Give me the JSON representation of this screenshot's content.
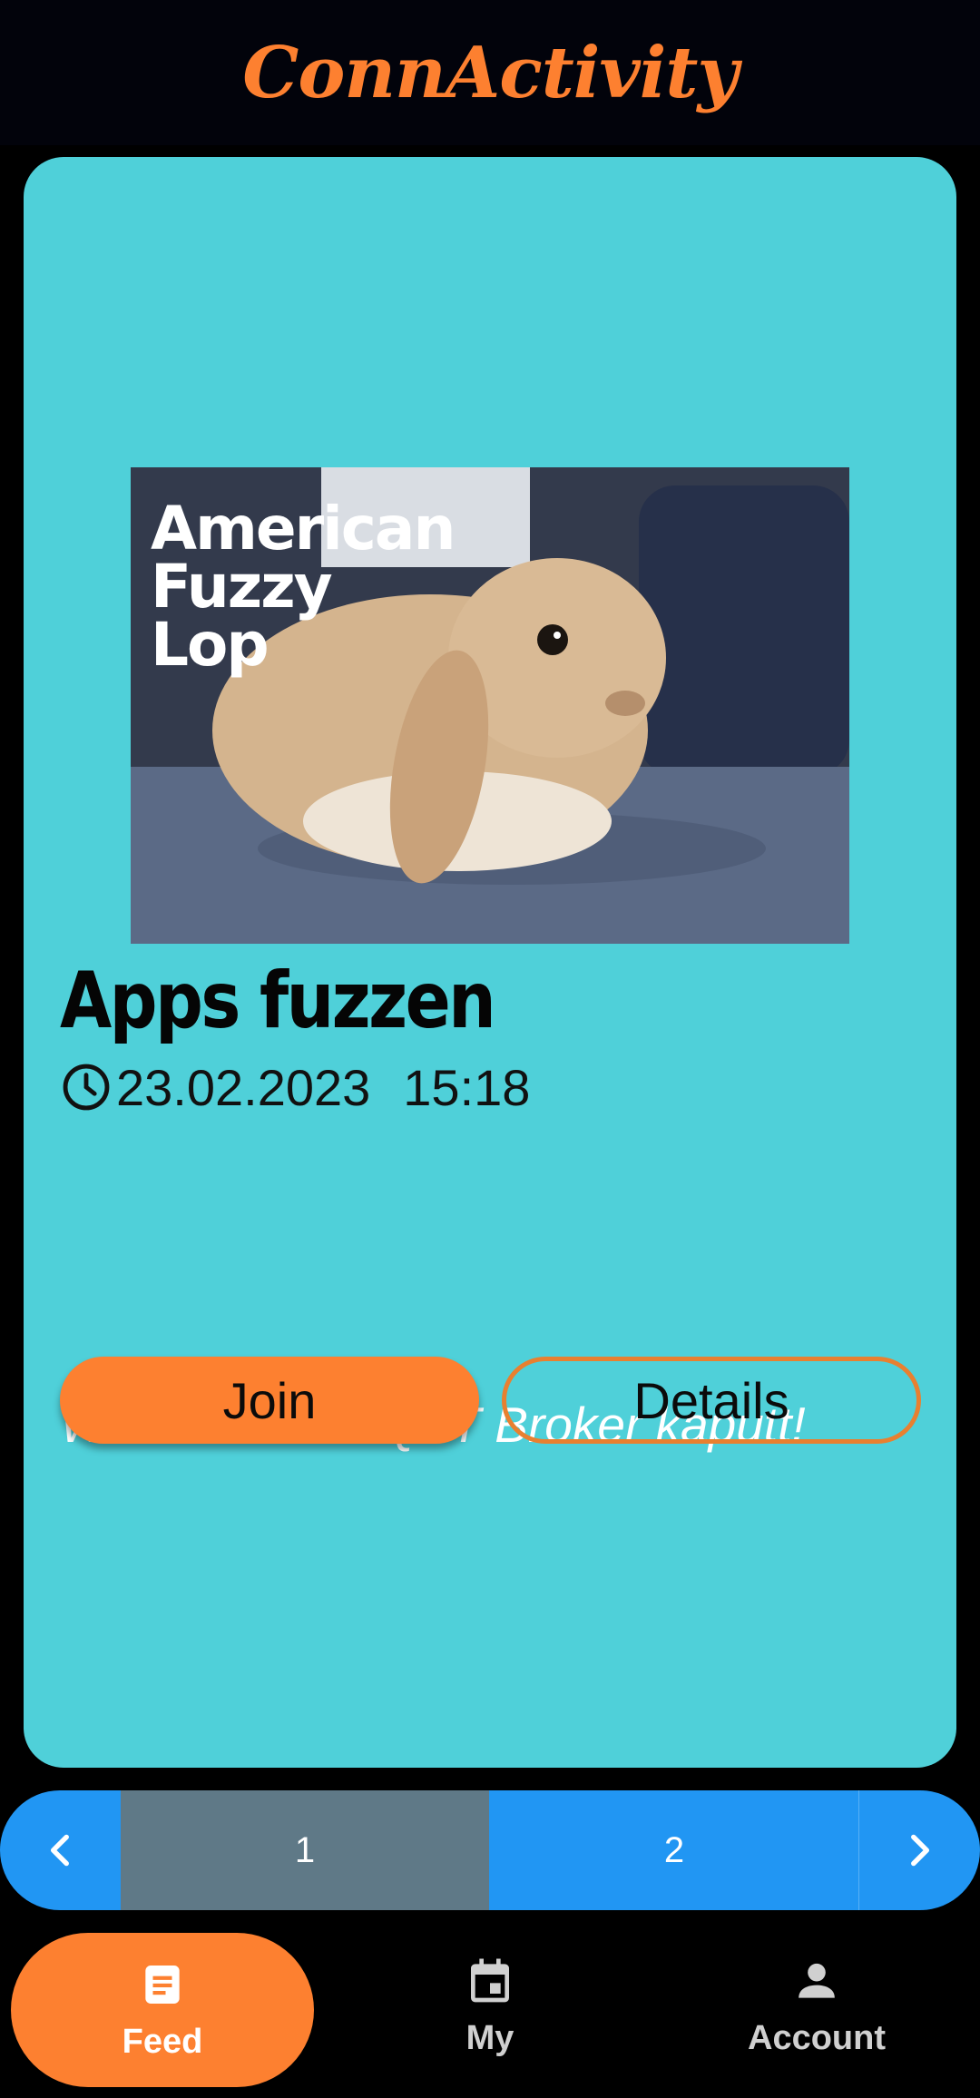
{
  "header": {
    "title": "ConnActivity"
  },
  "card": {
    "image_text": [
      "American",
      "Fuzzy",
      "Lop"
    ],
    "title": "Apps fuzzen",
    "date": "23.02.2023",
    "time": "15:18",
    "description": "Wir machen MQTT Broker kaputt!",
    "join_label": "Join",
    "details_label": "Details"
  },
  "pager": {
    "pages": [
      "1",
      "2"
    ],
    "current_page": 1
  },
  "nav": {
    "items": [
      {
        "label": "Feed",
        "icon": "document-icon",
        "active": true
      },
      {
        "label": "My",
        "icon": "calendar-icon",
        "active": false
      },
      {
        "label": "Account",
        "icon": "person-icon",
        "active": false
      }
    ]
  },
  "colors": {
    "brand": "#fd8030",
    "card": "#4fd0d9",
    "pager": "#2196f3",
    "pager_active": "#5f7987"
  }
}
